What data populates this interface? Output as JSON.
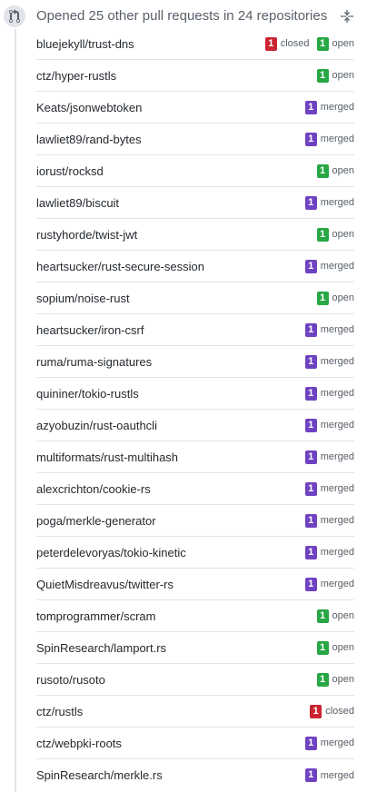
{
  "header": {
    "title": "Opened 25 other pull requests in 24 repositories",
    "icon": "git-pull-request-icon",
    "collapse_icon": "fold-icon"
  },
  "colors": {
    "merged": "#6f42c1",
    "open": "#28a745",
    "closed": "#cb2431"
  },
  "repositories": [
    {
      "name": "bluejekyll/trust-dns",
      "states": [
        {
          "count": "1",
          "label": "closed",
          "type": "closed"
        },
        {
          "count": "1",
          "label": "open",
          "type": "open"
        }
      ]
    },
    {
      "name": "ctz/hyper-rustls",
      "states": [
        {
          "count": "1",
          "label": "open",
          "type": "open"
        }
      ]
    },
    {
      "name": "Keats/jsonwebtoken",
      "states": [
        {
          "count": "1",
          "label": "merged",
          "type": "merged"
        }
      ]
    },
    {
      "name": "lawliet89/rand-bytes",
      "states": [
        {
          "count": "1",
          "label": "merged",
          "type": "merged"
        }
      ]
    },
    {
      "name": "iorust/rocksd",
      "states": [
        {
          "count": "1",
          "label": "open",
          "type": "open"
        }
      ]
    },
    {
      "name": "lawliet89/biscuit",
      "states": [
        {
          "count": "1",
          "label": "merged",
          "type": "merged"
        }
      ]
    },
    {
      "name": "rustyhorde/twist-jwt",
      "states": [
        {
          "count": "1",
          "label": "open",
          "type": "open"
        }
      ]
    },
    {
      "name": "heartsucker/rust-secure-session",
      "states": [
        {
          "count": "1",
          "label": "merged",
          "type": "merged"
        }
      ]
    },
    {
      "name": "sopium/noise-rust",
      "states": [
        {
          "count": "1",
          "label": "open",
          "type": "open"
        }
      ]
    },
    {
      "name": "heartsucker/iron-csrf",
      "states": [
        {
          "count": "1",
          "label": "merged",
          "type": "merged"
        }
      ]
    },
    {
      "name": "ruma/ruma-signatures",
      "states": [
        {
          "count": "1",
          "label": "merged",
          "type": "merged"
        }
      ]
    },
    {
      "name": "quininer/tokio-rustls",
      "states": [
        {
          "count": "1",
          "label": "merged",
          "type": "merged"
        }
      ]
    },
    {
      "name": "azyobuzin/rust-oauthcli",
      "states": [
        {
          "count": "1",
          "label": "merged",
          "type": "merged"
        }
      ]
    },
    {
      "name": "multiformats/rust-multihash",
      "states": [
        {
          "count": "1",
          "label": "merged",
          "type": "merged"
        }
      ]
    },
    {
      "name": "alexcrichton/cookie-rs",
      "states": [
        {
          "count": "1",
          "label": "merged",
          "type": "merged"
        }
      ]
    },
    {
      "name": "poga/merkle-generator",
      "states": [
        {
          "count": "1",
          "label": "merged",
          "type": "merged"
        }
      ]
    },
    {
      "name": "peterdelevoryas/tokio-kinetic",
      "states": [
        {
          "count": "1",
          "label": "merged",
          "type": "merged"
        }
      ]
    },
    {
      "name": "QuietMisdreavus/twitter-rs",
      "states": [
        {
          "count": "1",
          "label": "merged",
          "type": "merged"
        }
      ]
    },
    {
      "name": "tomprogrammer/scram",
      "states": [
        {
          "count": "1",
          "label": "open",
          "type": "open"
        }
      ]
    },
    {
      "name": "SpinResearch/lamport.rs",
      "states": [
        {
          "count": "1",
          "label": "open",
          "type": "open"
        }
      ]
    },
    {
      "name": "rusoto/rusoto",
      "states": [
        {
          "count": "1",
          "label": "open",
          "type": "open"
        }
      ]
    },
    {
      "name": "ctz/rustls",
      "states": [
        {
          "count": "1",
          "label": "closed",
          "type": "closed"
        }
      ]
    },
    {
      "name": "ctz/webpki-roots",
      "states": [
        {
          "count": "1",
          "label": "merged",
          "type": "merged"
        }
      ]
    },
    {
      "name": "SpinResearch/merkle.rs",
      "states": [
        {
          "count": "1",
          "label": "merged",
          "type": "merged"
        }
      ]
    }
  ]
}
